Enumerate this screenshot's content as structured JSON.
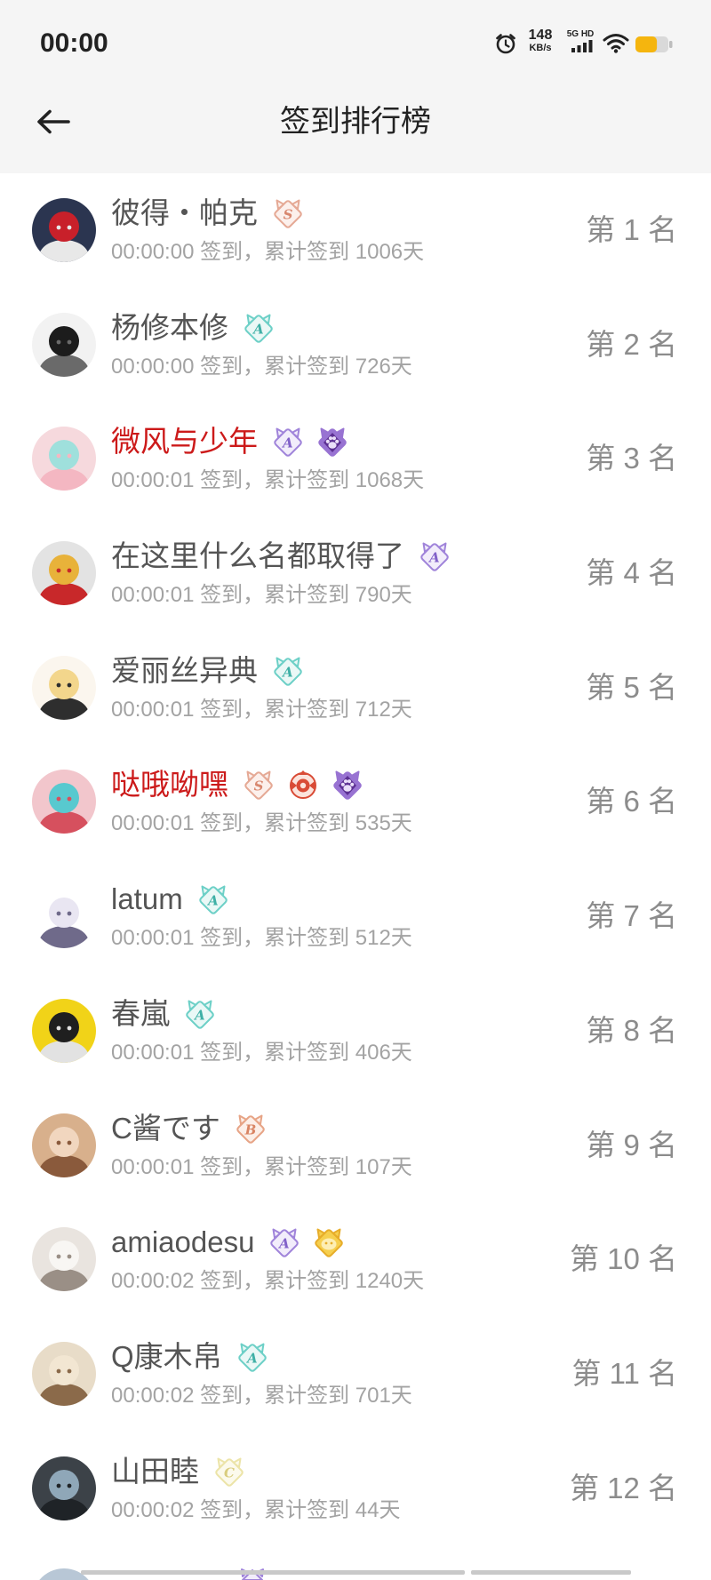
{
  "status": {
    "time": "00:00",
    "net_speed": "148",
    "net_unit": "KB/s",
    "network_label": "5G HD",
    "battery_level": 0.65,
    "battery_color": "#f5b50e",
    "icons": {
      "alarm": "alarm-icon",
      "signal": "signal-icon",
      "wifi": "wifi-icon",
      "battery": "battery-icon"
    }
  },
  "header": {
    "title": "签到排行榜",
    "back_icon": "back-arrow-icon"
  },
  "colors": {
    "header_bg": "#f5f5f5",
    "name": "#555555",
    "highlight_name": "#cc1a1a",
    "info": "#a3a3a3",
    "rank": "#8c8c8c"
  },
  "rows": [
    {
      "name": "彼得・帕克",
      "name_color": "#555555",
      "info": "00:00:00 签到，累计签到 1006天",
      "rank": "第 1 名",
      "avatar": {
        "bg": "#2b3550",
        "fg": "#c8202a",
        "accent": "#e8e8e8"
      },
      "badges": [
        {
          "icon": "level-badge-icon",
          "letter": "S",
          "stroke": "#e5a995",
          "fill": "#fcf0ec",
          "text": "#d8876f"
        }
      ]
    },
    {
      "name": "杨修本修",
      "name_color": "#555555",
      "info": "00:00:00 签到，累计签到 726天",
      "rank": "第 2 名",
      "avatar": {
        "bg": "#f2f2f2",
        "fg": "#1c1c1c",
        "accent": "#6a6a6a"
      },
      "badges": [
        {
          "icon": "level-badge-icon",
          "letter": "A",
          "stroke": "#6dd0c7",
          "fill": "#eaf8f6",
          "text": "#3fb0a6"
        }
      ]
    },
    {
      "name": "微风与少年",
      "name_color": "#cc1a1a",
      "info": "00:00:01 签到，累计签到 1068天",
      "rank": "第 3 名",
      "avatar": {
        "bg": "#f6d9dd",
        "fg": "#9fe0dc",
        "accent": "#f4b7c2"
      },
      "badges": [
        {
          "icon": "level-badge-icon",
          "letter": "A",
          "stroke": "#a084da",
          "fill": "#f2edfb",
          "text": "#8262c9"
        },
        {
          "icon": "paw-badge-icon",
          "color": "#9873d2",
          "inner": "#5c2f92",
          "paw": "#eadff9"
        }
      ]
    },
    {
      "name": "在这里什么名都取得了",
      "name_color": "#555555",
      "info": "00:00:01 签到，累计签到 790天",
      "rank": "第 4 名",
      "avatar": {
        "bg": "#e3e3e3",
        "fg": "#e8b23a",
        "accent": "#c8282a"
      },
      "badges": [
        {
          "icon": "level-badge-icon",
          "letter": "A",
          "stroke": "#a084da",
          "fill": "#f2edfb",
          "text": "#8262c9"
        }
      ]
    },
    {
      "name": "爱丽丝异典",
      "name_color": "#555555",
      "info": "00:00:01 签到，累计签到 712天",
      "rank": "第 5 名",
      "avatar": {
        "bg": "#fbf6ee",
        "fg": "#f3d68c",
        "accent": "#2e2e2e"
      },
      "badges": [
        {
          "icon": "level-badge-icon",
          "letter": "A",
          "stroke": "#6dd0c7",
          "fill": "#eaf8f6",
          "text": "#3fb0a6"
        }
      ]
    },
    {
      "name": "哒哦呦嘿",
      "name_color": "#cc1a1a",
      "info": "00:00:01 签到，累计签到 535天",
      "rank": "第 6 名",
      "avatar": {
        "bg": "#f2c6cc",
        "fg": "#58c9cf",
        "accent": "#d6505e"
      },
      "badges": [
        {
          "icon": "level-badge-icon",
          "letter": "S",
          "stroke": "#e5a995",
          "fill": "#fcf0ec",
          "text": "#d8876f"
        },
        {
          "icon": "crest-badge-icon",
          "color": "#d94b36",
          "fill": "#fbe3dc"
        },
        {
          "icon": "paw-badge-icon",
          "color": "#9873d2",
          "inner": "#5c2f92",
          "paw": "#eadff9"
        }
      ]
    },
    {
      "name": "latum",
      "name_color": "#555555",
      "info": "00:00:01 签到，累计签到 512天",
      "rank": "第 7 名",
      "avatar": {
        "bg": "#ffffff",
        "fg": "#e9e6f2",
        "accent": "#6f6a8a"
      },
      "badges": [
        {
          "icon": "level-badge-icon",
          "letter": "A",
          "stroke": "#6dd0c7",
          "fill": "#eaf8f6",
          "text": "#3fb0a6"
        }
      ]
    },
    {
      "name": "春嵐",
      "name_color": "#555555",
      "info": "00:00:01 签到，累计签到 406天",
      "rank": "第 8 名",
      "avatar": {
        "bg": "#f1d318",
        "fg": "#1f1f1f",
        "accent": "#e2e2e2"
      },
      "badges": [
        {
          "icon": "level-badge-icon",
          "letter": "A",
          "stroke": "#6dd0c7",
          "fill": "#eaf8f6",
          "text": "#3fb0a6"
        }
      ]
    },
    {
      "name": "C酱です",
      "name_color": "#555555",
      "info": "00:00:01 签到，累计签到 107天",
      "rank": "第 9 名",
      "avatar": {
        "bg": "#d8b08c",
        "fg": "#f1d6bf",
        "accent": "#8a5a3c"
      },
      "badges": [
        {
          "icon": "level-badge-icon",
          "letter": "B",
          "stroke": "#e7a486",
          "fill": "#fcefe8",
          "text": "#d98463"
        }
      ]
    },
    {
      "name": "amiaodesu",
      "name_color": "#555555",
      "info": "00:00:02 签到，累计签到 1240天",
      "rank": "第 10 名",
      "avatar": {
        "bg": "#e9e4df",
        "fg": "#f8f6f3",
        "accent": "#9a8f86"
      },
      "badges": [
        {
          "icon": "level-badge-icon",
          "letter": "A",
          "stroke": "#a084da",
          "fill": "#f2edfb",
          "text": "#8262c9"
        },
        {
          "icon": "gold-badge-icon",
          "color": "#f6cf4e",
          "stroke": "#e7ad2a",
          "inner": "#fdeeb4"
        }
      ]
    },
    {
      "name": "Q康木帛",
      "name_color": "#555555",
      "info": "00:00:02 签到，累计签到 701天",
      "rank": "第 11 名",
      "avatar": {
        "bg": "#e8dcc8",
        "fg": "#f2e6d2",
        "accent": "#8b6a4a"
      },
      "badges": [
        {
          "icon": "level-badge-icon",
          "letter": "A",
          "stroke": "#6dd0c7",
          "fill": "#eaf8f6",
          "text": "#3fb0a6"
        }
      ]
    },
    {
      "name": "山田睦",
      "name_color": "#555555",
      "info": "00:00:02 签到，累计签到 44天",
      "rank": "第 12 名",
      "avatar": {
        "bg": "#3c4248",
        "fg": "#8fa7b8",
        "accent": "#1f2327"
      },
      "badges": [
        {
          "icon": "level-badge-icon",
          "letter": "C",
          "stroke": "#ece4a8",
          "fill": "#fcfaec",
          "text": "#d9cd7f"
        }
      ]
    }
  ]
}
